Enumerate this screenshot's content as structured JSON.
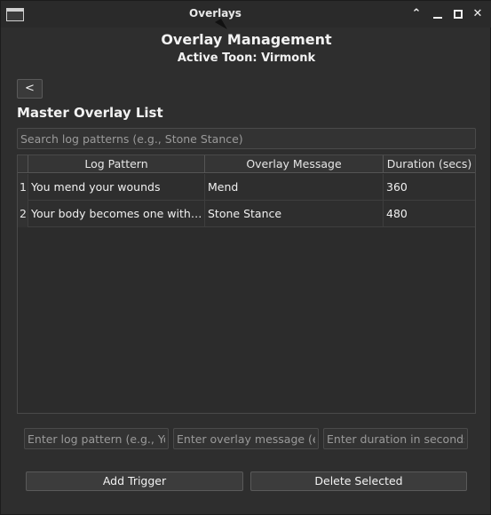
{
  "window": {
    "title": "Overlays",
    "buttons": [
      "up-arrow",
      "minimize",
      "maximize",
      "close"
    ]
  },
  "header": {
    "title": "Overlay Management",
    "active_toon": "Active Toon: Virmonk"
  },
  "back_button": {
    "label": "<"
  },
  "section": {
    "title": "Master Overlay List"
  },
  "search": {
    "placeholder": "Search log patterns (e.g., Stone Stance)",
    "value": ""
  },
  "table": {
    "columns": [
      "Log Pattern",
      "Overlay Message",
      "Duration (secs)"
    ],
    "rows": [
      {
        "index": "1",
        "pattern": "You mend your wounds",
        "message": "Mend",
        "duration": "360"
      },
      {
        "index": "2",
        "pattern": "Your body becomes one with the...",
        "message": "Stone Stance",
        "duration": "480"
      }
    ]
  },
  "form": {
    "pattern_placeholder": "Enter log pattern (e.g., Yo...",
    "message_placeholder": "Enter overlay message (e....",
    "duration_placeholder": "Enter duration in seconds ..."
  },
  "actions": {
    "add_label": "Add Trigger",
    "delete_label": "Delete Selected"
  },
  "colors": {
    "background": "#2e2e2e",
    "text": "#f0f0f0",
    "border": "#4a4a4a"
  }
}
